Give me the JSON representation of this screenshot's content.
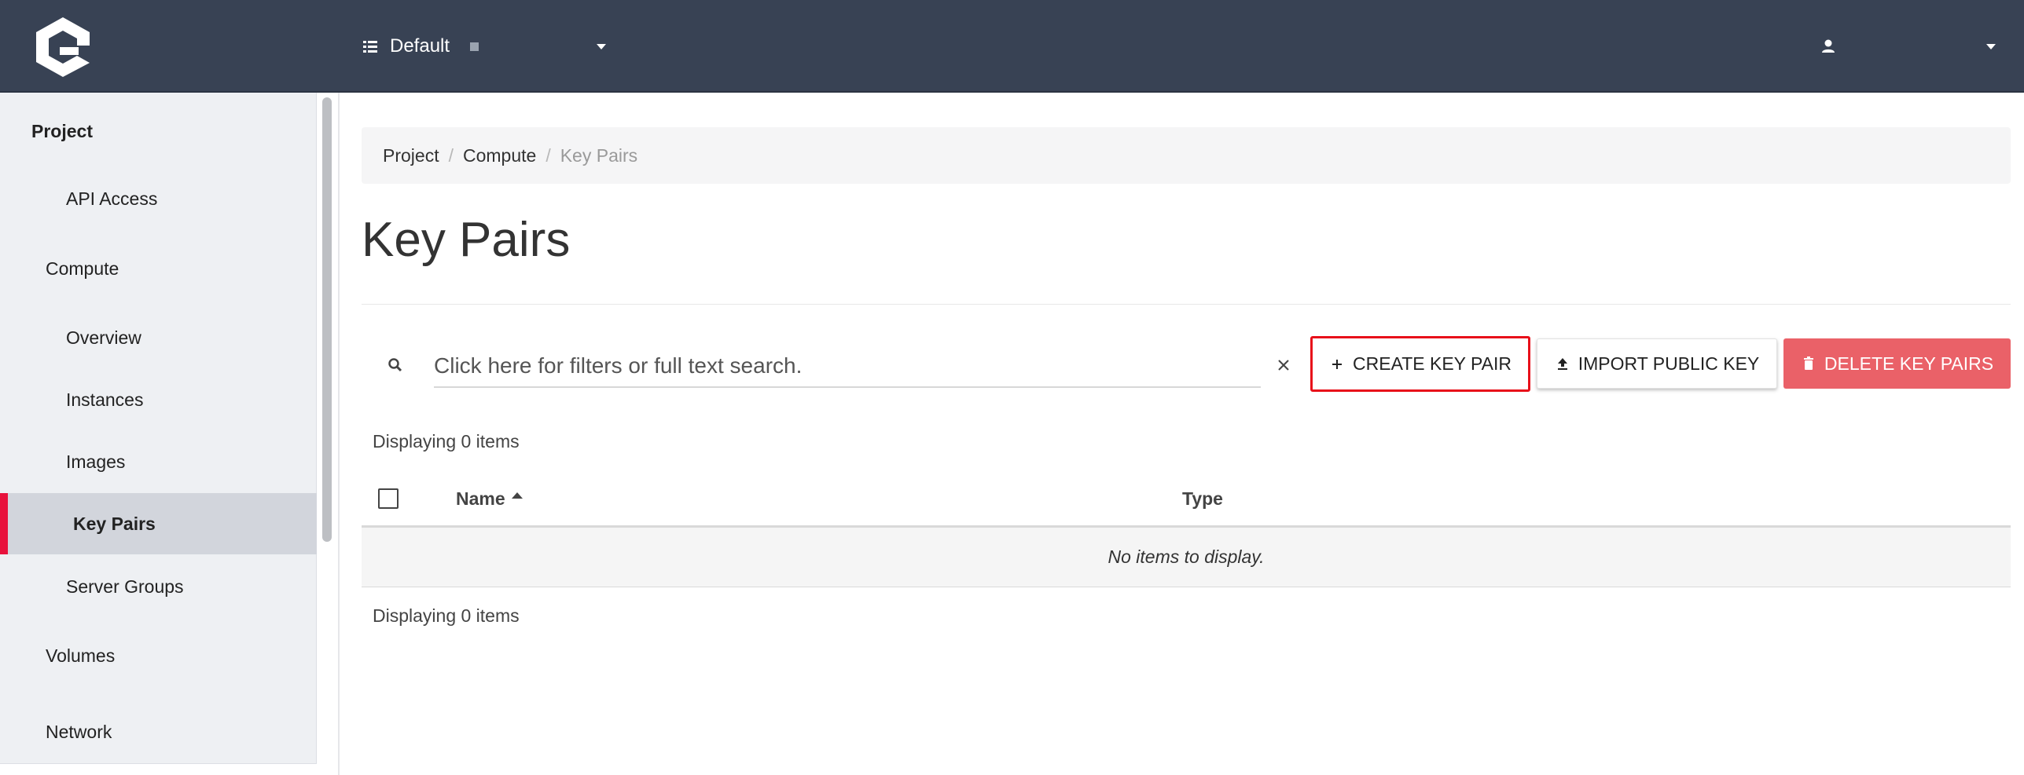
{
  "header": {
    "project_name": "Default",
    "user_name": ""
  },
  "sidebar": {
    "items": [
      {
        "label": "Project"
      },
      {
        "label": "API Access"
      },
      {
        "label": "Compute"
      },
      {
        "label": "Overview"
      },
      {
        "label": "Instances"
      },
      {
        "label": "Images"
      },
      {
        "label": "Key Pairs"
      },
      {
        "label": "Server Groups"
      },
      {
        "label": "Volumes"
      },
      {
        "label": "Network"
      }
    ]
  },
  "breadcrumb": [
    "Project",
    "Compute",
    "Key Pairs"
  ],
  "page": {
    "title": "Key Pairs"
  },
  "search": {
    "placeholder": "Click here for filters or full text search."
  },
  "actions": {
    "create": "CREATE KEY PAIR",
    "import": "IMPORT PUBLIC KEY",
    "delete": "DELETE KEY PAIRS"
  },
  "table": {
    "count_top": "Displaying 0 items",
    "count_bottom": "Displaying 0 items",
    "columns": [
      "Name",
      "Type"
    ],
    "empty_message": "No items to display."
  },
  "colors": {
    "topbar": "#384254",
    "active_accent": "#e8123c",
    "delete_button": "#ea6168",
    "highlight_border": "#e8101a"
  }
}
